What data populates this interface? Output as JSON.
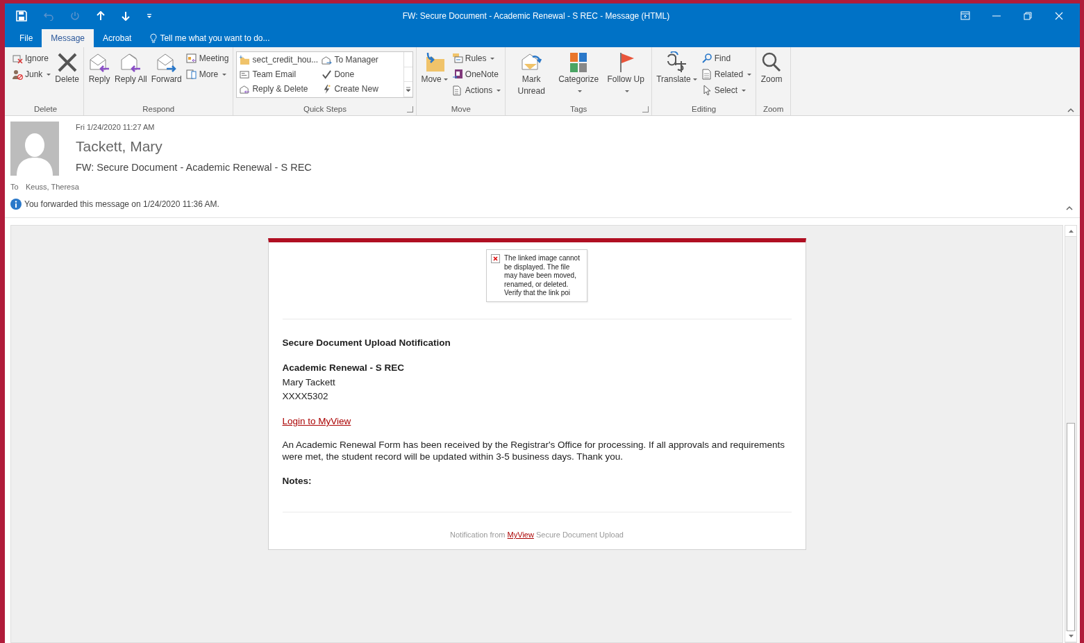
{
  "window": {
    "title": "FW: Secure Document - Academic Renewal - S REC - Message (HTML)"
  },
  "tabs": [
    {
      "label": "File",
      "selected": false
    },
    {
      "label": "Message",
      "selected": true
    },
    {
      "label": "Acrobat",
      "selected": false
    }
  ],
  "tell_me": {
    "placeholder": "Tell me what you want to do..."
  },
  "ribbon": {
    "groups": [
      {
        "label": "Delete",
        "launcher": false,
        "items": [
          {
            "kind": "small",
            "label": "Ignore",
            "dropdown": false
          },
          {
            "kind": "small",
            "label": "Junk",
            "dropdown": true
          },
          {
            "kind": "large",
            "label": "Delete",
            "dropdown": false
          }
        ]
      },
      {
        "label": "Respond",
        "launcher": false,
        "items": [
          {
            "kind": "large",
            "label": "Reply",
            "dropdown": false
          },
          {
            "kind": "large",
            "label": "Reply All",
            "dropdown": false
          },
          {
            "kind": "large",
            "label": "Forward",
            "dropdown": false
          },
          {
            "kind": "small",
            "label": "Meeting",
            "dropdown": false
          },
          {
            "kind": "small",
            "label": "More",
            "dropdown": true
          }
        ]
      },
      {
        "label": "Quick Steps",
        "launcher": true,
        "items": [
          {
            "kind": "gallery",
            "label": "sect_credit_hou..."
          },
          {
            "kind": "gallery",
            "label": "Team Email"
          },
          {
            "kind": "gallery",
            "label": "Reply & Delete"
          },
          {
            "kind": "gallery",
            "label": "To Manager"
          },
          {
            "kind": "gallery",
            "label": "Done"
          },
          {
            "kind": "gallery",
            "label": "Create New"
          }
        ]
      },
      {
        "label": "Move",
        "launcher": false,
        "items": [
          {
            "kind": "large",
            "label": "Move",
            "dropdown": true
          },
          {
            "kind": "small",
            "label": "Rules",
            "dropdown": true
          },
          {
            "kind": "small",
            "label": "OneNote",
            "dropdown": false
          },
          {
            "kind": "small",
            "label": "Actions",
            "dropdown": true
          }
        ]
      },
      {
        "label": "Tags",
        "launcher": true,
        "items": [
          {
            "kind": "large",
            "label": "Mark Unread",
            "dropdown": false
          },
          {
            "kind": "large",
            "label": "Categorize",
            "dropdown": true
          },
          {
            "kind": "large",
            "label": "Follow Up",
            "dropdown": true
          }
        ]
      },
      {
        "label": "Editing",
        "launcher": false,
        "items": [
          {
            "kind": "large",
            "label": "Translate",
            "dropdown": true
          },
          {
            "kind": "small",
            "label": "Find",
            "dropdown": false
          },
          {
            "kind": "small",
            "label": "Related",
            "dropdown": true
          },
          {
            "kind": "small",
            "label": "Select",
            "dropdown": true
          }
        ]
      },
      {
        "label": "Zoom",
        "launcher": false,
        "items": [
          {
            "kind": "large",
            "label": "Zoom",
            "dropdown": false
          }
        ]
      }
    ]
  },
  "message": {
    "date": "Fri 1/24/2020 11:27 AM",
    "sender": "Tackett, Mary",
    "subject": "FW: Secure Document - Academic Renewal - S REC",
    "to_label": "To",
    "to": "Keuss, Theresa",
    "info": "You forwarded this message on 1/24/2020 11:36 AM."
  },
  "email": {
    "broken_image": "The linked image cannot be displayed.  The file may have been moved, renamed, or deleted. Verify that the link poi",
    "heading": "Secure Document Upload Notification",
    "title": "Academic Renewal - S REC",
    "name": "Mary Tackett",
    "id": "XXXX5302",
    "link": "Login to MyView",
    "body": "An Academic Renewal Form has been received by the Registrar's Office for processing. If all approvals and requirements were met, the student record will be updated within 3-5 business days. Thank you.",
    "notes_label": "Notes:",
    "footer_before": "Notification from",
    "footer_link": "MyView",
    "footer_after": "Secure Document Upload"
  }
}
